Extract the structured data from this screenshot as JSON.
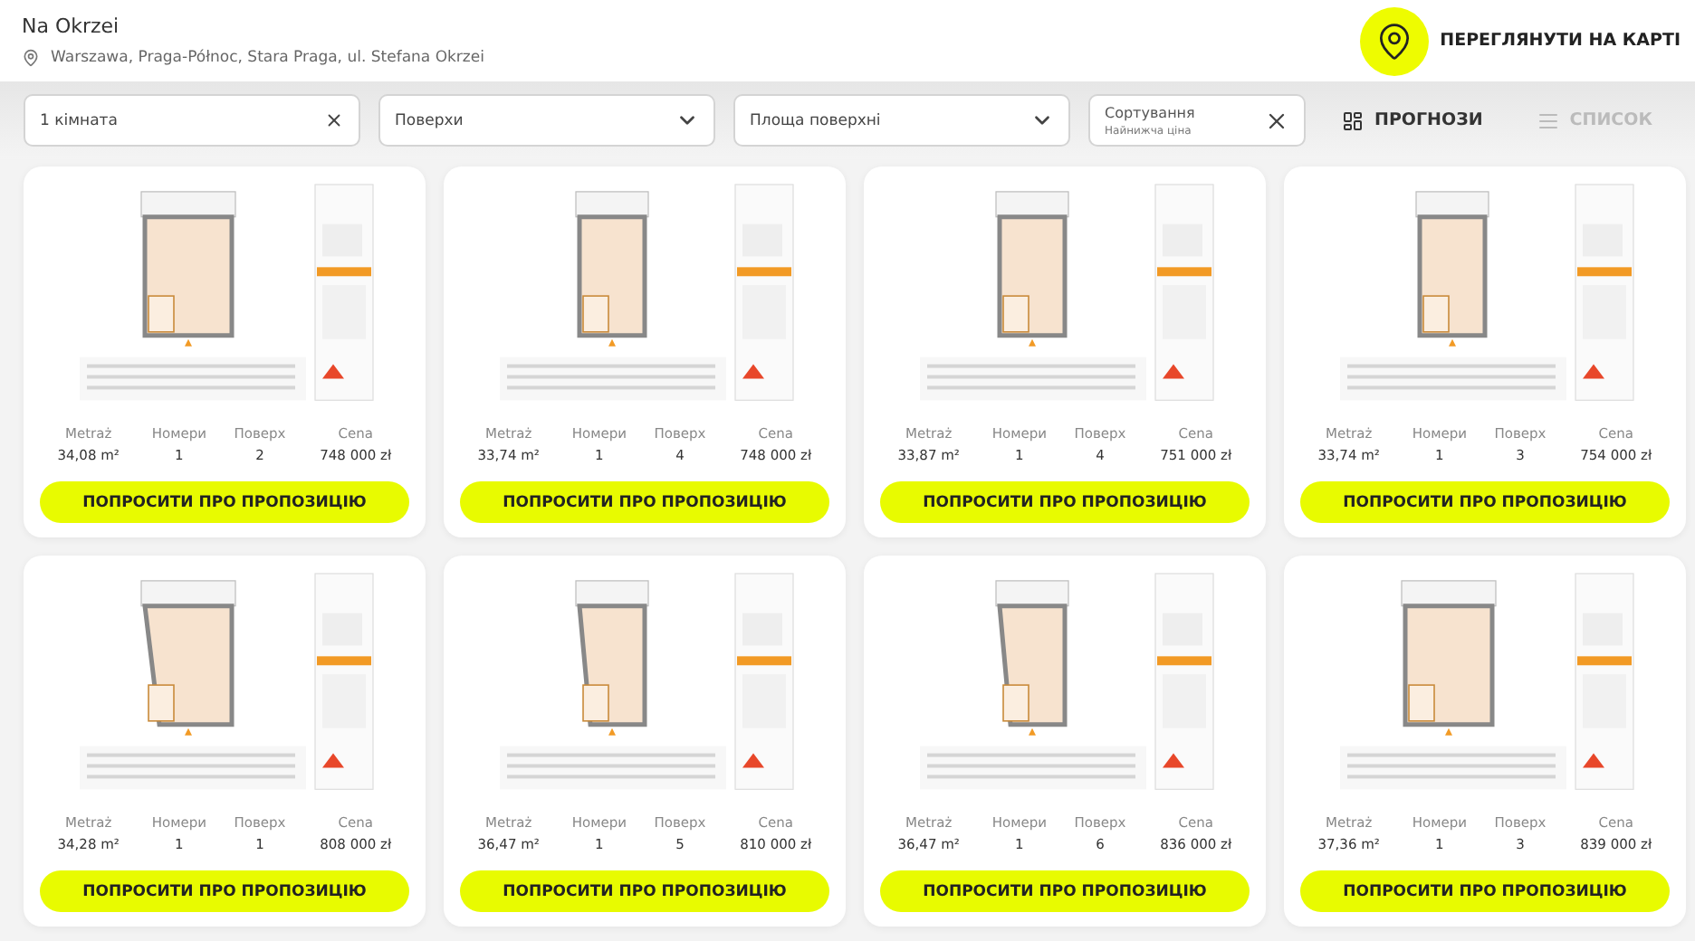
{
  "header": {
    "title": "Na Okrzei",
    "address": "Warszawa, Praga-Północ, Stara Praga, ul. Stefana Okrzei",
    "map_button": "ПЕРЕГЛЯНУТИ НА КАРТІ"
  },
  "filters": [
    {
      "kind": "clearable",
      "value": "1 кімната"
    },
    {
      "kind": "dropdown",
      "value": "Поверхи"
    },
    {
      "kind": "dropdown",
      "value": "Площа поверхні"
    },
    {
      "kind": "sort",
      "label": "Сортування",
      "value": "Найнижча ціна"
    }
  ],
  "views": [
    {
      "kind": "plans",
      "label": "ПРОГНОЗИ",
      "selected": true
    },
    {
      "kind": "list",
      "label": "СПИСОК",
      "selected": false
    }
  ],
  "cards": [
    {
      "stats": [
        {
          "label": "Metraż",
          "value": "34,08 m²"
        },
        {
          "label": "Номери",
          "value": "1"
        },
        {
          "label": "Поверх",
          "value": "2"
        },
        {
          "label": "Cena",
          "value": "748 000 zł"
        }
      ],
      "button": "ПОПРОСИТИ ПРО ПРОПОЗИЦІЮ"
    },
    {
      "stats": [
        {
          "label": "Metraż",
          "value": "33,74 m²"
        },
        {
          "label": "Номери",
          "value": "1"
        },
        {
          "label": "Поверх",
          "value": "4"
        },
        {
          "label": "Cena",
          "value": "748 000 zł"
        }
      ],
      "button": "ПОПРОСИТИ ПРО ПРОПОЗИЦІЮ"
    },
    {
      "stats": [
        {
          "label": "Metraż",
          "value": "33,87 m²"
        },
        {
          "label": "Номери",
          "value": "1"
        },
        {
          "label": "Поверх",
          "value": "4"
        },
        {
          "label": "Cena",
          "value": "751 000 zł"
        }
      ],
      "button": "ПОПРОСИТИ ПРО ПРОПОЗИЦІЮ"
    },
    {
      "stats": [
        {
          "label": "Metraż",
          "value": "33,74 m²"
        },
        {
          "label": "Номери",
          "value": "1"
        },
        {
          "label": "Поверх",
          "value": "3"
        },
        {
          "label": "Cena",
          "value": "754 000 zł"
        }
      ],
      "button": "ПОПРОСИТИ ПРО ПРОПОЗИЦІЮ"
    },
    {
      "stats": [
        {
          "label": "Metraż",
          "value": "34,28 m²"
        },
        {
          "label": "Номери",
          "value": "1"
        },
        {
          "label": "Поверх",
          "value": "1"
        },
        {
          "label": "Cena",
          "value": "808 000 zł"
        }
      ],
      "button": "ПОПРОСИТИ ПРО ПРОПОЗИЦІЮ"
    },
    {
      "stats": [
        {
          "label": "Metraż",
          "value": "36,47 m²"
        },
        {
          "label": "Номери",
          "value": "1"
        },
        {
          "label": "Поверх",
          "value": "5"
        },
        {
          "label": "Cena",
          "value": "810 000 zł"
        }
      ],
      "button": "ПОПРОСИТИ ПРО ПРОПОЗИЦІЮ"
    },
    {
      "stats": [
        {
          "label": "Metraż",
          "value": "36,47 m²"
        },
        {
          "label": "Номери",
          "value": "1"
        },
        {
          "label": "Поверх",
          "value": "6"
        },
        {
          "label": "Cena",
          "value": "836 000 zł"
        }
      ],
      "button": "ПОПРОСИТИ ПРО ПРОПОЗИЦІЮ"
    },
    {
      "stats": [
        {
          "label": "Metraż",
          "value": "37,36 m²"
        },
        {
          "label": "Номери",
          "value": "1"
        },
        {
          "label": "Поверх",
          "value": "3"
        },
        {
          "label": "Cena",
          "value": "839 000 zł"
        }
      ],
      "button": "ПОПРОСИТИ ПРО ПРОПОЗИЦІЮ"
    }
  ]
}
